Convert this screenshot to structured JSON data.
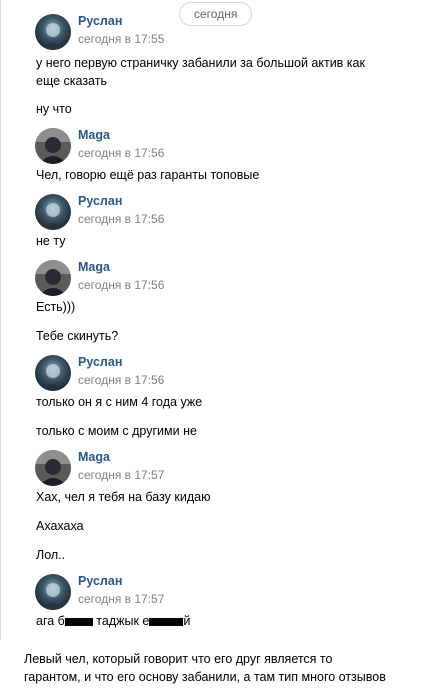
{
  "date_divider": "сегодня",
  "messages": [
    {
      "author": "Руслан",
      "time": "сегодня в 17:55",
      "avatar": "ruslan-avatar",
      "lines": [
        "у него первую страничку забанили за большой актив как",
        "еще сказать",
        "ну что"
      ]
    },
    {
      "author": "Maga",
      "time": "сегодня в 17:56",
      "avatar": "maga-avatar",
      "lines": [
        "Чел, говорю ещё раз гаранты топовые"
      ]
    },
    {
      "author": "Руслан",
      "time": "сегодня в 17:56",
      "avatar": "ruslan-avatar",
      "lines": [
        "не ту"
      ]
    },
    {
      "author": "Maga",
      "time": "сегодня в 17:56",
      "avatar": "maga-avatar",
      "lines": [
        "Есть)))",
        "Тебе скинуть?"
      ]
    },
    {
      "author": "Руслан",
      "time": "сегодня в 17:56",
      "avatar": "ruslan-avatar",
      "lines": [
        "только он я с ним 4 года уже",
        "только с моим с другими не"
      ]
    },
    {
      "author": "Maga",
      "time": "сегодня в 17:57",
      "avatar": "maga-avatar",
      "lines": [
        "Хах, чел я тебя на базу кидаю",
        "Ахахаха",
        "Лол.."
      ]
    },
    {
      "author": "Руслан",
      "time": "сегодня в 17:57",
      "avatar": "ruslan-avatar",
      "redacted_line": {
        "part1": "ага б",
        "part2": " таджык е",
        "part3": "й"
      }
    }
  ],
  "caption": {
    "line1": "Левый чел, который говорит что его друг является то",
    "line2": "гарантом, и что его основу забанили, а там тип много отзывов"
  }
}
